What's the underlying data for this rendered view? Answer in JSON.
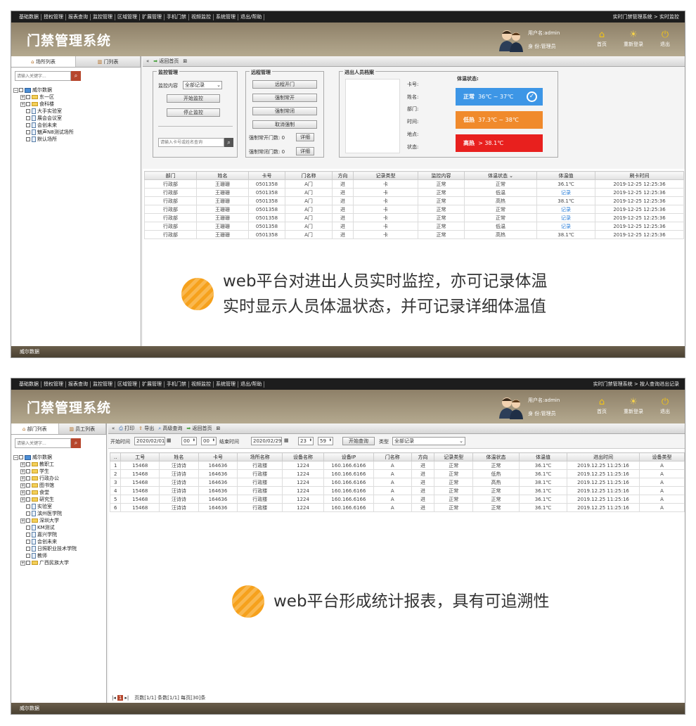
{
  "menu": [
    "基础数据",
    "授权管理",
    "报表查询",
    "监控管理",
    "区域管理",
    "扩展管理",
    "手机门禁",
    "视频监控",
    "系统管理",
    "退出/帮助"
  ],
  "app_title": "门禁管理系统",
  "user": {
    "name_line": "用户名:admin",
    "role_line": "身  份:管理员"
  },
  "header_buttons": [
    "首页",
    "重新登录",
    "退出"
  ],
  "footer": "威尔数据",
  "s1": {
    "crumb": "实时门禁管理系统 > 实时监控",
    "tabs": [
      "场所列表",
      "门列表"
    ],
    "search_placeholder": "请输入关键字...",
    "tree": [
      "威尔数据",
      "东一区",
      "食科楼",
      "大手实验室",
      "展会会议室",
      "会创未来",
      "魅声N8测试场所",
      "默认场所"
    ],
    "toolbar_back": "返回首页",
    "monitor": {
      "title": "监控管理",
      "content_label": "监控内容",
      "content_value": "全部记录",
      "start": "开始监控",
      "stop": "停止监控",
      "search_placeholder": "请输入卡号或姓名查询"
    },
    "remote": {
      "title": "远程管理",
      "buttons": [
        "远程开门",
        "强制常开",
        "强制常闭",
        "取消强制"
      ],
      "open_label": "强制常开门数: 0",
      "close_label": "强制常闭门数: 0",
      "detail": "详细"
    },
    "person": {
      "title": "进出人员档案",
      "fields": [
        "卡号:",
        "姓名:",
        "部门:",
        "时间:",
        "地点:",
        "状态:"
      ],
      "temp_title": "体温状态:"
    },
    "status": [
      {
        "level": "正常",
        "range": "36℃ ~ 37℃",
        "color": "#3d96e6"
      },
      {
        "level": "低热",
        "range": "37.3℃ ~ 38℃",
        "color": "#f08a2c"
      },
      {
        "level": "高热",
        "range": "> 38.1℃",
        "color": "#e8201e"
      }
    ],
    "columns": [
      "部门",
      "姓名",
      "卡号",
      "门名称",
      "方向",
      "记录类型",
      "监控内容",
      "体温状态 ⌄",
      "体温值",
      "刷卡时间"
    ],
    "rows": [
      [
        "行政部",
        "王珊珊",
        "0501358",
        "A门",
        "进",
        "卡",
        "正常",
        "正常",
        "36.1℃",
        "2019-12-25 12:25:36"
      ],
      [
        "行政部",
        "王珊珊",
        "0501358",
        "A门",
        "进",
        "卡",
        "正常",
        "低温",
        "记录",
        "2019-12-25 12:25:36"
      ],
      [
        "行政部",
        "王珊珊",
        "0501358",
        "A门",
        "进",
        "卡",
        "正常",
        "高热",
        "38.1℃",
        "2019-12-25 12:25:36"
      ],
      [
        "行政部",
        "王珊珊",
        "0501358",
        "A门",
        "进",
        "卡",
        "正常",
        "正常",
        "记录",
        "2019-12-25 12:25:36"
      ],
      [
        "行政部",
        "王珊珊",
        "0501358",
        "A门",
        "进",
        "卡",
        "正常",
        "正常",
        "记录",
        "2019-12-25 12:25:36"
      ],
      [
        "行政部",
        "王珊珊",
        "0501358",
        "A门",
        "进",
        "卡",
        "正常",
        "低温",
        "记录",
        "2019-12-25 12:25:36"
      ],
      [
        "行政部",
        "王珊珊",
        "0501358",
        "A门",
        "进",
        "卡",
        "正常",
        "高热",
        "38.1℃",
        "2019-12-25 12:25:36"
      ]
    ],
    "overlay": [
      "web平台对进出人员实时监控，亦可记录体温",
      "实时显示人员体温状态，并可记录详细体温值"
    ]
  },
  "s2": {
    "crumb": "实时门禁管理系统 > 按人查询进出记录",
    "tabs": [
      "部门列表",
      "员工列表"
    ],
    "search_placeholder": "请输入关键字...",
    "tree": [
      "威尔数据",
      "教职工",
      "学生",
      "行政办公",
      "图书馆",
      "食堂",
      "研究生",
      "实验室",
      "滨州医学院",
      "深圳大学",
      "KM测试",
      "嘉兴学院",
      "会创未来",
      "日照职业技术学院",
      "教师",
      "广西民族大学"
    ],
    "toolbar": [
      "打印",
      "导出",
      "高级查询",
      "返回首页"
    ],
    "filter": {
      "start_label": "开始时间",
      "start_date": "2020/02/01",
      "start_h": "00",
      "start_m": "00",
      "end_label": "结束时间",
      "end_date": "2020/02/29",
      "end_h": "23",
      "end_m": "59",
      "query": "开始查询",
      "type_label": "类型",
      "type_value": "全部记录"
    },
    "columns": [
      "..",
      "工号",
      "姓名",
      "卡号",
      "场所名称",
      "设备名称",
      "设备IP",
      "门名称",
      "方向",
      "记录类型",
      "体温状态",
      "体温值",
      "进出时间",
      "设备类型"
    ],
    "rows": [
      [
        "1",
        "15468",
        "汪诗诗",
        "164636",
        "行政楼",
        "1224",
        "160.166.6166",
        "A",
        "进",
        "正常",
        "正常",
        "36.1℃",
        "2019.12.25 11:25:16",
        "A"
      ],
      [
        "2",
        "15468",
        "汪诗诗",
        "164636",
        "行政楼",
        "1224",
        "160.166.6166",
        "A",
        "进",
        "正常",
        "低热",
        "36.1℃",
        "2019.12.25 11:25:16",
        "A"
      ],
      [
        "3",
        "15468",
        "汪诗诗",
        "164636",
        "行政楼",
        "1224",
        "160.166.6166",
        "A",
        "进",
        "正常",
        "高热",
        "38.1℃",
        "2019.12.25 11:25:16",
        "A"
      ],
      [
        "4",
        "15468",
        "汪诗诗",
        "164636",
        "行政楼",
        "1224",
        "160.166.6166",
        "A",
        "进",
        "正常",
        "正常",
        "36.1℃",
        "2019.12.25 11:25:16",
        "A"
      ],
      [
        "5",
        "15468",
        "汪诗诗",
        "164636",
        "行政楼",
        "1224",
        "160.166.6166",
        "A",
        "进",
        "正常",
        "正常",
        "36.1℃",
        "2019.12.25 11:25:16",
        "A"
      ],
      [
        "6",
        "15468",
        "汪诗诗",
        "164636",
        "行政楼",
        "1224",
        "160.166.6166",
        "A",
        "进",
        "正常",
        "正常",
        "36.1℃",
        "2019.12.25 11:25:16",
        "A"
      ]
    ],
    "pager": {
      "current": "1",
      "info": "页数[1/1] 条数[1/1] 每页[30]条"
    },
    "overlay": "web平台形成统计报表，具有可追溯性"
  }
}
